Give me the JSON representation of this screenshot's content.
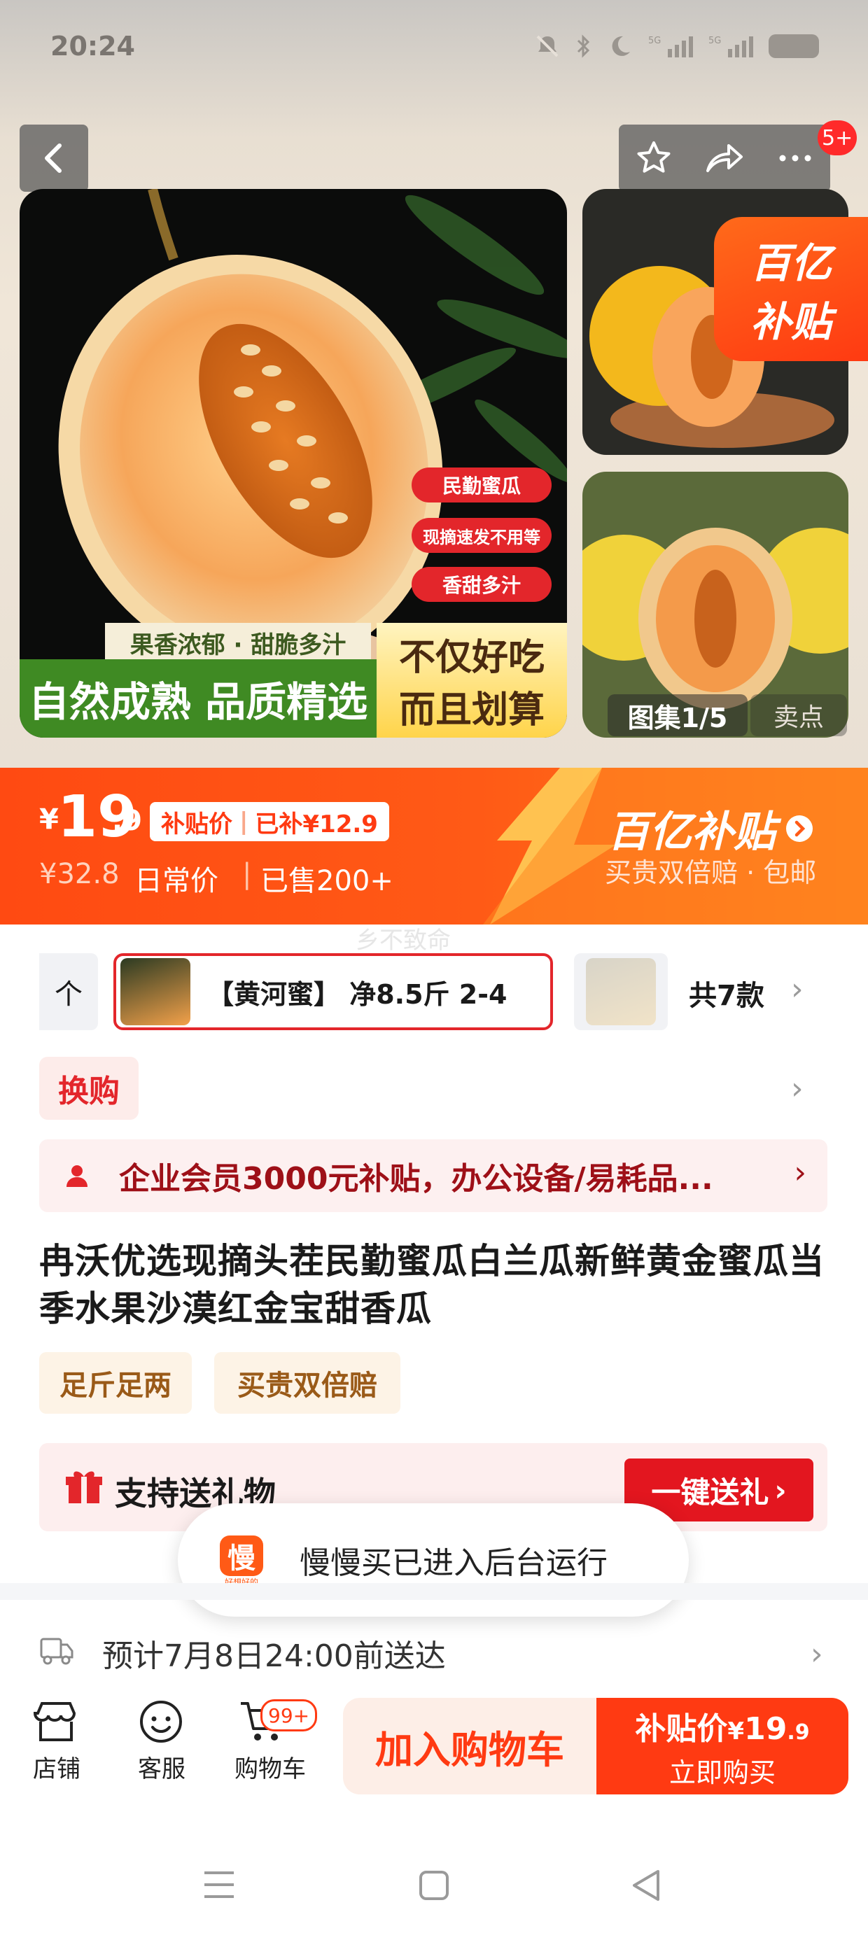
{
  "status_bar": {
    "time": "20:24"
  },
  "top_nav": {
    "badge": "5+"
  },
  "gallery": {
    "main_labels": [
      "民勤蜜瓜",
      "现摘速发不用等",
      "香甜多汁"
    ],
    "banner_small": "果香浓郁 · 甜脆多汁",
    "banner_big": "自然成熟 品质精选",
    "banner_right_1": "不仅好吃",
    "banner_right_2": "而且划算",
    "subsidy_badge_1": "百亿",
    "subsidy_badge_2": "补贴",
    "album": "图集1/5",
    "selling_point": "卖点"
  },
  "price_bar": {
    "currency": "¥",
    "price_int": "19",
    "price_dec": ".9",
    "price_tag": "补贴价",
    "subsidized": "已补¥12.9",
    "original": "¥32.8",
    "daily_label": "日常价",
    "sold": "已售200+",
    "brand": "百亿补贴",
    "brand_sub": "买贵双倍赔 · 包邮"
  },
  "watermark": "乡不致命",
  "sku": {
    "left_partial": "个",
    "selected": "【黄河蜜】 净8.5斤 2-4",
    "total": "共7款"
  },
  "exchange": {
    "label": "换购"
  },
  "promo": {
    "text": "企业会员3000元补贴，办公设备/易耗品..."
  },
  "product": {
    "title": "冉沃优选现摘头茬民勤蜜瓜白兰瓜新鲜黄金蜜瓜当季水果沙漠红金宝甜香瓜",
    "tags": [
      "足斤足两",
      "买贵双倍赔"
    ]
  },
  "gift": {
    "label": "支持送礼物",
    "button": "一键送礼"
  },
  "toast": {
    "app_icon_text": "慢",
    "app_icon_sub": "好想好的",
    "text": "慢慢买已进入后台运行"
  },
  "delivery": {
    "text": "预计7月8日24:00前送达"
  },
  "bottom_bar": {
    "shop": "店铺",
    "service": "客服",
    "cart": "购物车",
    "cart_badge": "99+",
    "add_cart": "加入购物车",
    "buy_price_label": "补贴价",
    "buy_currency": "¥",
    "buy_price_int": "19",
    "buy_price_dec": ".9",
    "buy_now": "立即购买"
  },
  "colors": {
    "accent": "#ff4a12",
    "red": "#e3262b",
    "dark_red": "#a0121a"
  }
}
